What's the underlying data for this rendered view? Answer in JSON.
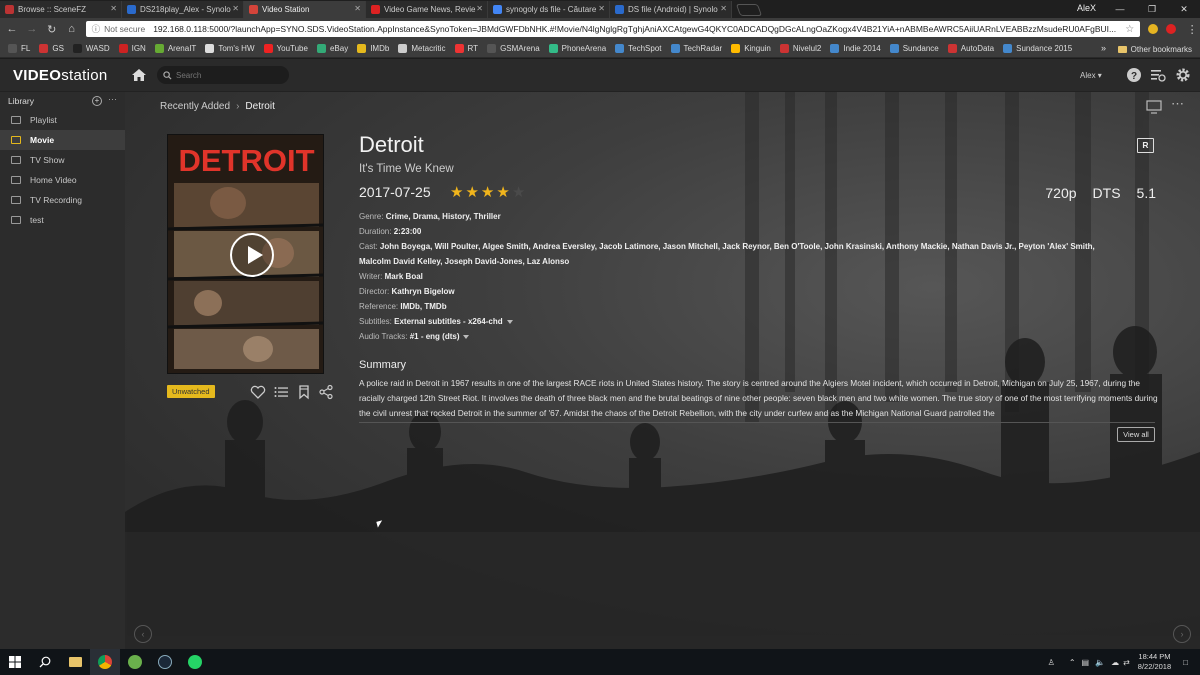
{
  "browser": {
    "tabs": [
      {
        "label": "Browse :: SceneFZ",
        "color": "#b33",
        "active": false
      },
      {
        "label": "DS218play_Alex - Synolo",
        "color": "#2a6acc",
        "active": false
      },
      {
        "label": "Video Station",
        "color": "#d4443a",
        "active": true
      },
      {
        "label": "Video Game News, Revie",
        "color": "#d22",
        "active": false
      },
      {
        "label": "synogoly ds file - Căutare",
        "color": "#4285f4",
        "active": false
      },
      {
        "label": "DS file (Android) | Synolo",
        "color": "#2a6acc",
        "active": false
      }
    ],
    "window_user": "AleX",
    "window_buttons": [
      "—",
      "❐",
      "✕"
    ],
    "security_label": "Not secure",
    "url": "192.168.0.118:5000/?launchApp=SYNO.SDS.VideoStation.AppInstance&SynoToken=JBMdGWFDbNHK.#!Movie/N4lgNglgRgTghjAniAXCAtgewG4QKYC0ADCADQgDGcALngOaZKogx4V4B21YiA+nABMBeAWRC5AiiUARnLVEABBzzMsudeRU0AFgBUI...",
    "bookmarks": [
      {
        "label": "FL",
        "color": "#555"
      },
      {
        "label": "GS",
        "color": "#c33"
      },
      {
        "label": "WASD",
        "color": "#222"
      },
      {
        "label": "IGN",
        "color": "#c22"
      },
      {
        "label": "ArenaIT",
        "color": "#6a3"
      },
      {
        "label": "Tom's HW",
        "color": "#ddd"
      },
      {
        "label": "YouTube",
        "color": "#e22"
      },
      {
        "label": "eBay",
        "color": "#3a7"
      },
      {
        "label": "IMDb",
        "color": "#e5b91d"
      },
      {
        "label": "Metacritic",
        "color": "#ccc"
      },
      {
        "label": "RT",
        "color": "#e33"
      },
      {
        "label": "GSMArena",
        "color": "#555"
      },
      {
        "label": "PhoneArena",
        "color": "#3b8"
      },
      {
        "label": "TechSpot",
        "color": "#48c"
      },
      {
        "label": "TechRadar",
        "color": "#48c"
      },
      {
        "label": "Kinguin",
        "color": "#fb0"
      },
      {
        "label": "Nivelul2",
        "color": "#c33"
      },
      {
        "label": "Indie 2014",
        "color": "#48c"
      },
      {
        "label": "Sundance",
        "color": "#48c"
      },
      {
        "label": "AutoData",
        "color": "#c33"
      },
      {
        "label": "Sundance 2015",
        "color": "#48c"
      }
    ],
    "bookmarks_more": "»",
    "other_bookmarks": "Other bookmarks"
  },
  "app": {
    "logo_bold": "VIDEO",
    "logo_rest": "station",
    "search_placeholder": "Search",
    "user": "Alex ▾"
  },
  "sidebar": {
    "header": "Library",
    "more": "···",
    "items": [
      {
        "label": "Playlist",
        "active": false
      },
      {
        "label": "Movie",
        "active": true
      },
      {
        "label": "TV Show",
        "active": false
      },
      {
        "label": "Home Video",
        "active": false
      },
      {
        "label": "TV Recording",
        "active": false
      },
      {
        "label": "test",
        "active": false
      }
    ]
  },
  "breadcrumb": {
    "parent": "Recently Added",
    "sep": "›",
    "current": "Detroit"
  },
  "movie": {
    "poster_title": "DETROIT",
    "status_badge": "Unwatched",
    "title": "Detroit",
    "tagline": "It's Time We Knew",
    "date": "2017-07-25",
    "rating_stars": 4,
    "rating_max": 5,
    "resolution": "720p",
    "audio_codec": "DTS",
    "channels": "5.1",
    "content_rating": "R",
    "genre_label": "Genre:",
    "genre": "Crime, Drama, History, Thriller",
    "duration_label": "Duration:",
    "duration": "2:23:00",
    "cast_label": "Cast:",
    "cast_line1": "John Boyega, Will Poulter, Algee Smith, Andrea Eversley, Jacob Latimore, Jason Mitchell, Jack Reynor, Ben O'Toole, John Krasinski, Anthony Mackie, Nathan Davis Jr., Peyton 'Alex' Smith,",
    "cast_line2": "Malcolm David Kelley, Joseph David-Jones, Laz Alonso",
    "writer_label": "Writer:",
    "writer": "Mark Boal",
    "director_label": "Director:",
    "director": "Kathryn Bigelow",
    "reference_label": "Reference:",
    "reference": "IMDb, TMDb",
    "subtitles_label": "Subtitles:",
    "subtitles": "External subtitles - x264-chd",
    "audio_label": "Audio Tracks:",
    "audio": "#1 - eng (dts)",
    "summary_heading": "Summary",
    "summary": "A police raid in Detroit in 1967 results in one of the largest RACE riots in United States history. The story is centred around the Algiers Motel incident, which occurred in Detroit, Michigan on July 25, 1967, during the racially charged 12th Street Riot. It involves the death of three black men and the brutal beatings of nine other people: seven black men and two white women. The true story of one of the most terrifying moments during the civil unrest that rocked Detroit in the summer of '67. Amidst the chaos of the Detroit Rebellion, with the city under curfew and as the Michigan National Guard patrolled the",
    "view_all": "View all"
  },
  "taskbar": {
    "time": "18:44 PM",
    "date": "8/22/2018"
  },
  "colors": {
    "accent": "#e5b91d",
    "star_on": "#f1b51c",
    "poster_title": "#e0342a"
  }
}
